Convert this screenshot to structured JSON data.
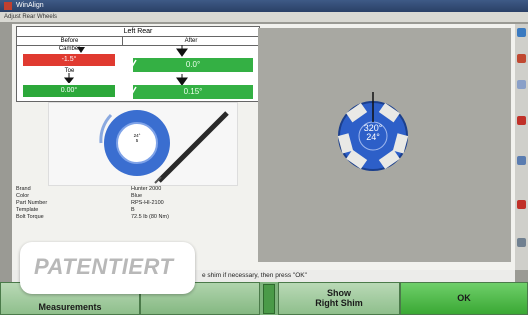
{
  "window": {
    "title": "WinAlign",
    "tab": "Adjust Rear Wheels"
  },
  "table": {
    "wheel": "Left Rear",
    "before_label": "Before",
    "after_label": "After",
    "camber_label": "Camber",
    "camber_before": "-1.5°",
    "camber_after": "0.0°",
    "toe_label": "Toe",
    "toe_before": "0.00°",
    "toe_after": "0.15°"
  },
  "specs": [
    {
      "key": "Brand",
      "value": "Hunter 2000"
    },
    {
      "key": "Color",
      "value": "Blue"
    },
    {
      "key": "Part Number",
      "value": "RPS-HI-2100"
    },
    {
      "key": "Template",
      "value": "B"
    },
    {
      "key": "Bolt Torque",
      "value": "72.5 lb (80 Nm)"
    }
  ],
  "shim_display": {
    "angle": "320°",
    "value": "24°"
  },
  "photo_label": {
    "line1": "24°",
    "line2": "5"
  },
  "status": {
    "message": "e shim if necessary, then press \"OK\""
  },
  "buttons": {
    "measurements": "Measurements",
    "show_line1": "Show",
    "show_line2": "Right Shim",
    "ok": "OK"
  },
  "watermark": "PATENTIERT",
  "colors": {
    "shim_blue": "#2d5fc8",
    "green": "#2ca83a",
    "red": "#e03a30",
    "ok_green": "#4cc045"
  }
}
